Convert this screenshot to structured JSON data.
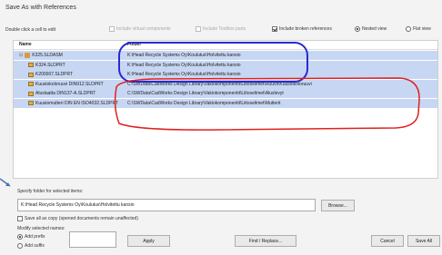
{
  "dialog": {
    "title": "Save As with References"
  },
  "toolbar": {
    "hint": "Double click a cell to edit",
    "include_virtual": "Include virtual components",
    "include_toolbox": "Include Toolbox parts",
    "include_broken": "Include broken references",
    "nested_view": "Nested view",
    "flat_view": "Flat view"
  },
  "table": {
    "headers": {
      "name": "Name",
      "folder": "Folder"
    },
    "rows": [
      {
        "toggle": "⊟",
        "icon": "assembly",
        "name": "K325.SLDASM",
        "folder": "K:\\Head Recycle Systems Oy\\Koulutus\\Holvitettu kansio"
      },
      {
        "toggle": "",
        "icon": "part",
        "name": "K324.SLDPRT",
        "folder": "K:\\Head Recycle Systems Oy\\Koulutus\\Holvitettu kansio"
      },
      {
        "toggle": "",
        "icon": "part",
        "name": "K200007.SLDPRT",
        "folder": "K:\\Head Recycle Systems Oy\\Koulutus\\Holvitettu kansio"
      },
      {
        "toggle": "",
        "icon": "part",
        "name": "Kuusiokoloruuvi DIN912.SLDPRT",
        "folder": "C:\\SWData\\CadWorks Design Library\\Vakiokomponentit\\Liitoselimet\\Ruuvit\\Kuusiokoloruuvi"
      },
      {
        "toggle": "",
        "icon": "part",
        "name": "Aluslaatta DIN137-A.SLDPRT",
        "folder": "C:\\SWData\\CadWorks Design Library\\Vakiokomponentit\\Liitoselimet\\Aluslevyt"
      },
      {
        "toggle": "",
        "icon": "part",
        "name": "Kuusiomutteri DIN EN ISO4032.SLDPRT",
        "folder": "C:\\SWData\\CadWorks Design Library\\Vakiokomponentit\\Liitoselimet\\Mutterit"
      }
    ]
  },
  "folder": {
    "label": "Specify folder for selected items:",
    "value": "K:\\Head Recycle Systems Oy\\Koulutus\\Holvitettu kansio",
    "browse": "Browse..."
  },
  "save_all": {
    "label": "Save all as copy (opened documents remain unaffected)"
  },
  "modify": {
    "label": "Modify selected names:",
    "add_prefix": "Add prefix",
    "add_suffix": "Add suffix",
    "apply": "Apply",
    "find_replace": "Find / Replace...",
    "cancel": "Cancel",
    "save_all": "Save All"
  },
  "colors": {
    "selection": "#c7d7f3",
    "blue_annotation": "#2a2ad0",
    "red_annotation": "#e0201c",
    "arrow": "#4a6fb5"
  }
}
